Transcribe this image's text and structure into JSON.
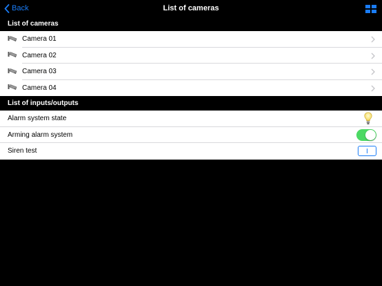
{
  "navbar": {
    "back_label": "Back",
    "title": "List of cameras",
    "right_icon": "grid-view-icon",
    "accent_color": "#1a7cf6"
  },
  "cameras_section": {
    "header": "List of cameras",
    "items": [
      {
        "label": "Camera 01",
        "icon": "camera-icon"
      },
      {
        "label": "Camera 02",
        "icon": "camera-icon"
      },
      {
        "label": "Camera 03",
        "icon": "camera-icon"
      },
      {
        "label": "Camera 04",
        "icon": "camera-icon"
      }
    ]
  },
  "io_section": {
    "header": "List of inputs/outputs",
    "items": [
      {
        "label": "Alarm system state",
        "control": "lightbulb-icon"
      },
      {
        "label": "Arming alarm system",
        "control": "toggle",
        "state": "on",
        "color": "#4cd964"
      },
      {
        "label": "Siren test",
        "control": "push-button"
      }
    ]
  }
}
